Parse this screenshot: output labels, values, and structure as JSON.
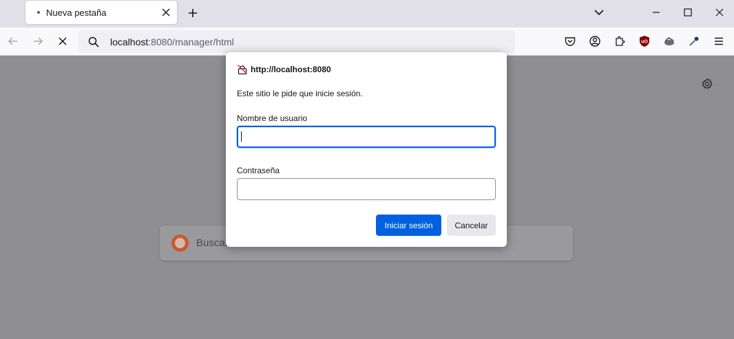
{
  "tabs": [
    {
      "title": "Nueva pestaña",
      "loading": true
    }
  ],
  "urlbar": {
    "host": "localhost",
    "rest": ":8080/manager/html"
  },
  "page": {
    "search_placeholder": "Buscar"
  },
  "dialog": {
    "origin": "http://localhost:8080",
    "message": "Este sitio le pide que inicie sesión.",
    "username_label": "Nombre de usuario",
    "username_value": "",
    "password_label": "Contraseña",
    "password_value": "",
    "login_button": "Iniciar sesión",
    "cancel_button": "Cancelar"
  },
  "icons": {
    "toolbar": [
      "pocket-icon",
      "account-icon",
      "extensions-icon",
      "ublock-icon",
      "extension-animal-icon",
      "eyedropper-icon",
      "menu-icon"
    ]
  },
  "colors": {
    "accent": "#0061e0",
    "ublock": "#800000"
  }
}
